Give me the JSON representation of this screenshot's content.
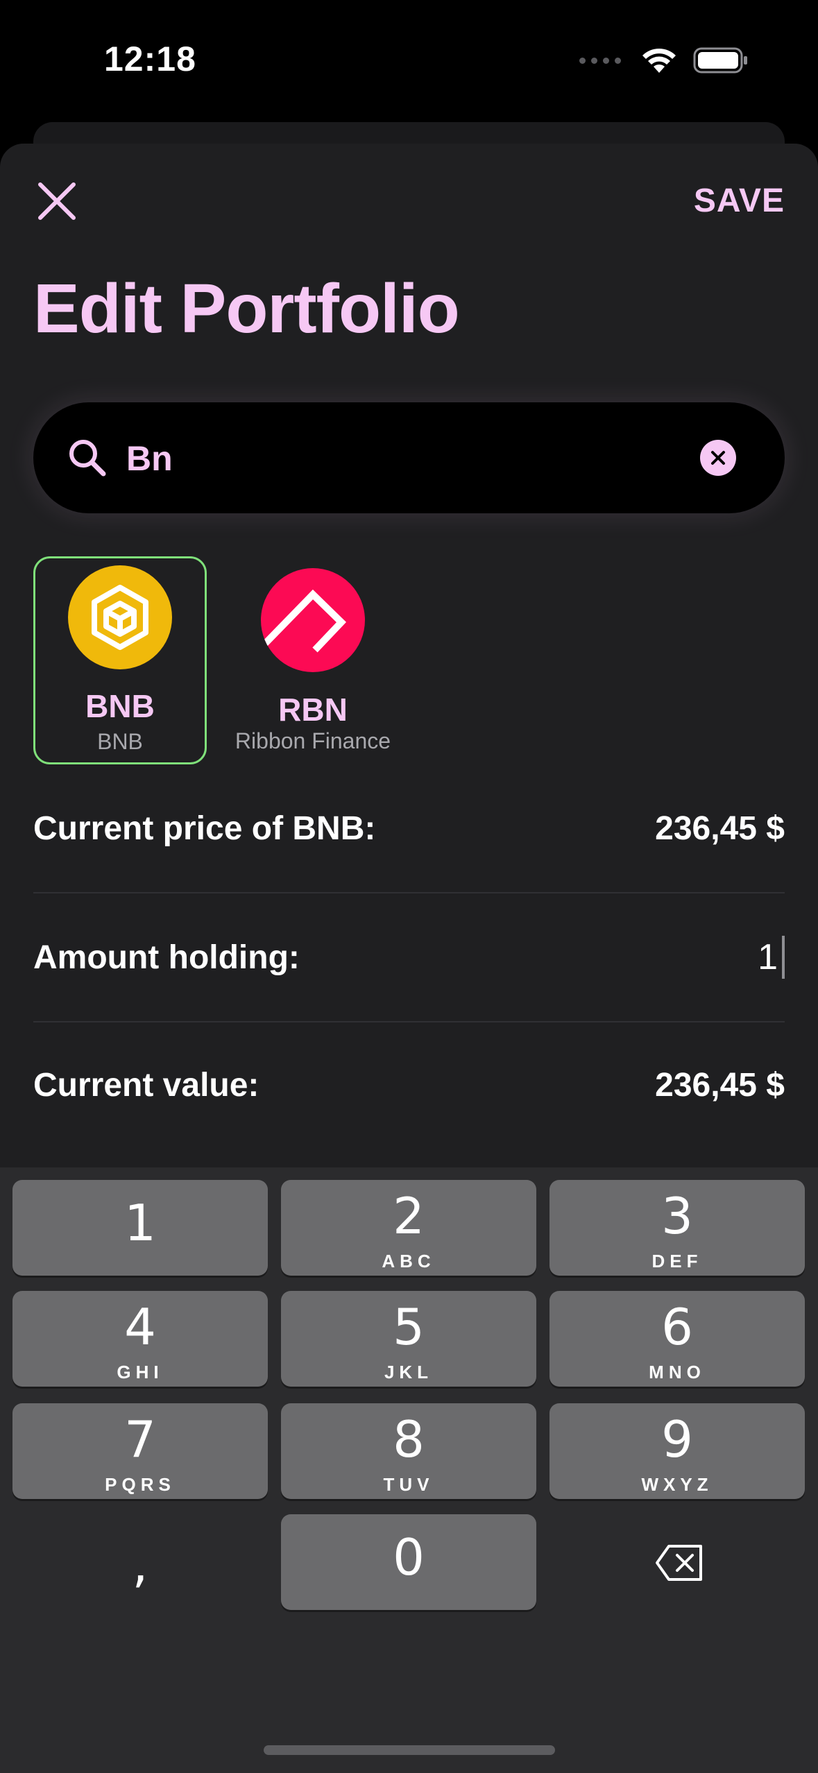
{
  "status_bar": {
    "time": "12:18"
  },
  "header": {
    "save_label": "SAVE",
    "title": "Edit Portfolio"
  },
  "search": {
    "value": "Bn"
  },
  "coins": [
    {
      "symbol": "BNB",
      "name": "BNB",
      "selected": true,
      "logo_color": "#F0B90B"
    },
    {
      "symbol": "RBN",
      "name": "Ribbon Finance",
      "selected": false,
      "logo_color": "#FC0A54"
    }
  ],
  "details": {
    "price_label": "Current price of BNB:",
    "price_value": "236,45 $",
    "amount_label": "Amount holding:",
    "amount_value": "1",
    "value_label": "Current value:",
    "value_value": "236,45 $"
  },
  "keypad": {
    "keys": [
      {
        "digit": "1",
        "letters": ""
      },
      {
        "digit": "2",
        "letters": "ABC"
      },
      {
        "digit": "3",
        "letters": "DEF"
      },
      {
        "digit": "4",
        "letters": "GHI"
      },
      {
        "digit": "5",
        "letters": "JKL"
      },
      {
        "digit": "6",
        "letters": "MNO"
      },
      {
        "digit": "7",
        "letters": "PQRS"
      },
      {
        "digit": "8",
        "letters": "TUV"
      },
      {
        "digit": "9",
        "letters": "WXYZ"
      },
      {
        "digit": "0",
        "letters": ""
      }
    ],
    "decimal": ","
  },
  "colors": {
    "accent": "#F6C8F4",
    "sheet_background": "#1F1F21",
    "selected_border": "#7FE07A"
  }
}
